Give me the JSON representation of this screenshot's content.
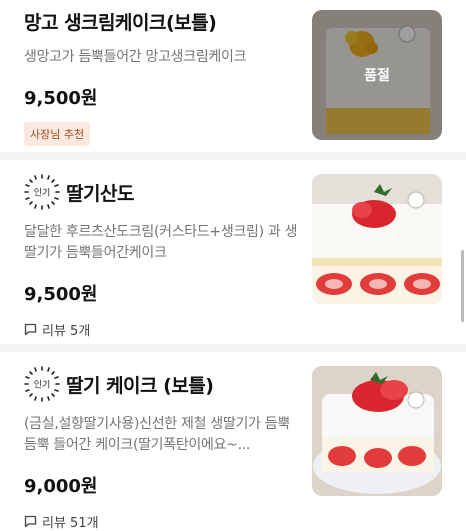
{
  "menu": {
    "items": [
      {
        "name": "망고 생크림케이크(보틀)",
        "description": "생망고가 듬뿍들어간 망고생크림케이크",
        "price": "9,500원",
        "tag": "사장님 추천",
        "soldout_label": "품절"
      },
      {
        "badge": "인기",
        "name": "딸기산도",
        "description": "달달한 후르츠산도크림(커스타드+생크림) 과 생딸기가 듬뿍들어간케이크",
        "price": "9,500원",
        "reviews": "리뷰 5개"
      },
      {
        "badge": "인기",
        "name": "딸기 케이크 (보틀)",
        "description": "(금실,설향딸기사용)신선한 제철 생딸기가 듬뿍듬뿍 들어간 케이크(딸기폭탄이에요~...",
        "price": "9,000원",
        "reviews": "리뷰 51개"
      }
    ]
  },
  "colors": {
    "tag_text": "#a8471e",
    "tag_bg": "#fbe9df",
    "divider": "#f2f3f5",
    "soldout_overlay": "rgba(0,0,0,0.38)"
  },
  "icons": {
    "popular_badge": "sunburst-badge-icon",
    "review": "speech-bubble-icon"
  }
}
